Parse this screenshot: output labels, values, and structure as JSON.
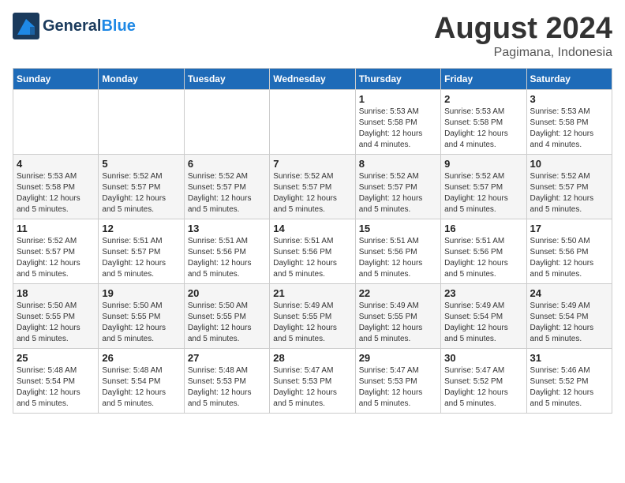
{
  "header": {
    "logo_general": "General",
    "logo_blue": "Blue",
    "month_year": "August 2024",
    "location": "Pagimana, Indonesia"
  },
  "weekdays": [
    "Sunday",
    "Monday",
    "Tuesday",
    "Wednesday",
    "Thursday",
    "Friday",
    "Saturday"
  ],
  "weeks": [
    [
      {
        "day": "",
        "info": ""
      },
      {
        "day": "",
        "info": ""
      },
      {
        "day": "",
        "info": ""
      },
      {
        "day": "",
        "info": ""
      },
      {
        "day": "1",
        "info": "Sunrise: 5:53 AM\nSunset: 5:58 PM\nDaylight: 12 hours\nand 4 minutes."
      },
      {
        "day": "2",
        "info": "Sunrise: 5:53 AM\nSunset: 5:58 PM\nDaylight: 12 hours\nand 4 minutes."
      },
      {
        "day": "3",
        "info": "Sunrise: 5:53 AM\nSunset: 5:58 PM\nDaylight: 12 hours\nand 4 minutes."
      }
    ],
    [
      {
        "day": "4",
        "info": "Sunrise: 5:53 AM\nSunset: 5:58 PM\nDaylight: 12 hours\nand 5 minutes."
      },
      {
        "day": "5",
        "info": "Sunrise: 5:52 AM\nSunset: 5:57 PM\nDaylight: 12 hours\nand 5 minutes."
      },
      {
        "day": "6",
        "info": "Sunrise: 5:52 AM\nSunset: 5:57 PM\nDaylight: 12 hours\nand 5 minutes."
      },
      {
        "day": "7",
        "info": "Sunrise: 5:52 AM\nSunset: 5:57 PM\nDaylight: 12 hours\nand 5 minutes."
      },
      {
        "day": "8",
        "info": "Sunrise: 5:52 AM\nSunset: 5:57 PM\nDaylight: 12 hours\nand 5 minutes."
      },
      {
        "day": "9",
        "info": "Sunrise: 5:52 AM\nSunset: 5:57 PM\nDaylight: 12 hours\nand 5 minutes."
      },
      {
        "day": "10",
        "info": "Sunrise: 5:52 AM\nSunset: 5:57 PM\nDaylight: 12 hours\nand 5 minutes."
      }
    ],
    [
      {
        "day": "11",
        "info": "Sunrise: 5:52 AM\nSunset: 5:57 PM\nDaylight: 12 hours\nand 5 minutes."
      },
      {
        "day": "12",
        "info": "Sunrise: 5:51 AM\nSunset: 5:57 PM\nDaylight: 12 hours\nand 5 minutes."
      },
      {
        "day": "13",
        "info": "Sunrise: 5:51 AM\nSunset: 5:56 PM\nDaylight: 12 hours\nand 5 minutes."
      },
      {
        "day": "14",
        "info": "Sunrise: 5:51 AM\nSunset: 5:56 PM\nDaylight: 12 hours\nand 5 minutes."
      },
      {
        "day": "15",
        "info": "Sunrise: 5:51 AM\nSunset: 5:56 PM\nDaylight: 12 hours\nand 5 minutes."
      },
      {
        "day": "16",
        "info": "Sunrise: 5:51 AM\nSunset: 5:56 PM\nDaylight: 12 hours\nand 5 minutes."
      },
      {
        "day": "17",
        "info": "Sunrise: 5:50 AM\nSunset: 5:56 PM\nDaylight: 12 hours\nand 5 minutes."
      }
    ],
    [
      {
        "day": "18",
        "info": "Sunrise: 5:50 AM\nSunset: 5:55 PM\nDaylight: 12 hours\nand 5 minutes."
      },
      {
        "day": "19",
        "info": "Sunrise: 5:50 AM\nSunset: 5:55 PM\nDaylight: 12 hours\nand 5 minutes."
      },
      {
        "day": "20",
        "info": "Sunrise: 5:50 AM\nSunset: 5:55 PM\nDaylight: 12 hours\nand 5 minutes."
      },
      {
        "day": "21",
        "info": "Sunrise: 5:49 AM\nSunset: 5:55 PM\nDaylight: 12 hours\nand 5 minutes."
      },
      {
        "day": "22",
        "info": "Sunrise: 5:49 AM\nSunset: 5:55 PM\nDaylight: 12 hours\nand 5 minutes."
      },
      {
        "day": "23",
        "info": "Sunrise: 5:49 AM\nSunset: 5:54 PM\nDaylight: 12 hours\nand 5 minutes."
      },
      {
        "day": "24",
        "info": "Sunrise: 5:49 AM\nSunset: 5:54 PM\nDaylight: 12 hours\nand 5 minutes."
      }
    ],
    [
      {
        "day": "25",
        "info": "Sunrise: 5:48 AM\nSunset: 5:54 PM\nDaylight: 12 hours\nand 5 minutes."
      },
      {
        "day": "26",
        "info": "Sunrise: 5:48 AM\nSunset: 5:54 PM\nDaylight: 12 hours\nand 5 minutes."
      },
      {
        "day": "27",
        "info": "Sunrise: 5:48 AM\nSunset: 5:53 PM\nDaylight: 12 hours\nand 5 minutes."
      },
      {
        "day": "28",
        "info": "Sunrise: 5:47 AM\nSunset: 5:53 PM\nDaylight: 12 hours\nand 5 minutes."
      },
      {
        "day": "29",
        "info": "Sunrise: 5:47 AM\nSunset: 5:53 PM\nDaylight: 12 hours\nand 5 minutes."
      },
      {
        "day": "30",
        "info": "Sunrise: 5:47 AM\nSunset: 5:52 PM\nDaylight: 12 hours\nand 5 minutes."
      },
      {
        "day": "31",
        "info": "Sunrise: 5:46 AM\nSunset: 5:52 PM\nDaylight: 12 hours\nand 5 minutes."
      }
    ]
  ]
}
